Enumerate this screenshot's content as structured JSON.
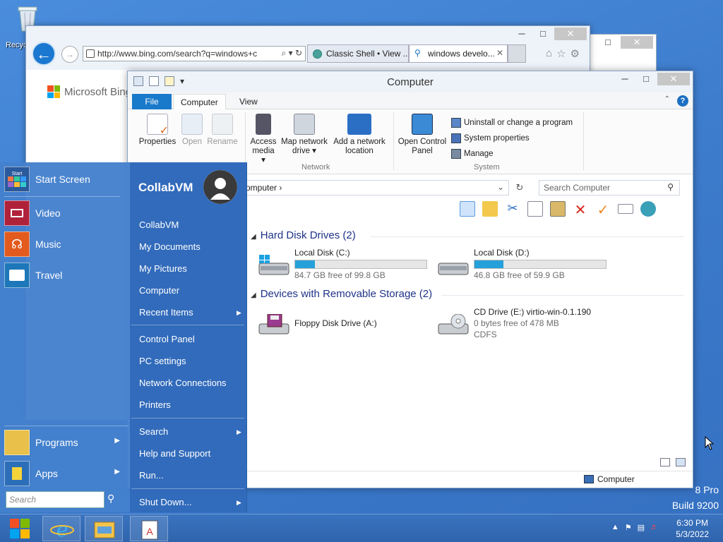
{
  "desktop": {
    "recycle_label": "Recyc",
    "watermark_line1": "8 Pro",
    "watermark_line2": "Build 9200"
  },
  "ie": {
    "address": "http://www.bing.com/search?q=windows+c",
    "address_tools": "⌕ ▾ ↻",
    "tabs": [
      {
        "label": "Classic Shell • View ..."
      },
      {
        "label": "windows develo...",
        "close": "✕"
      }
    ],
    "page_logo_text": "Microsoft Bing"
  },
  "explorer": {
    "title": "Computer",
    "ribbon_tabs": {
      "file": "File",
      "computer": "Computer",
      "view": "View"
    },
    "ribbon": {
      "properties": "Properties",
      "open": "Open",
      "rename": "Rename",
      "access_media": "Access media ▾",
      "map_network_drive": "Map network drive ▾",
      "add_network_location": "Add a network location",
      "open_control_panel": "Open Control Panel",
      "uninstall": "Uninstall or change a program",
      "system_properties": "System properties",
      "manage": "Manage",
      "group_network": "Network",
      "group_system": "System"
    },
    "breadcrumb": "omputer  ›",
    "search_placeholder": "Search Computer",
    "groups": {
      "hard_disk": "Hard Disk Drives (2)",
      "removable": "Devices with Removable Storage (2)"
    },
    "drives": [
      {
        "name": "Local Disk (C:)",
        "free": "84.7 GB free of 99.8 GB",
        "used_fraction": 0.15
      },
      {
        "name": "Local Disk (D:)",
        "free": "46.8 GB free of 59.9 GB",
        "used_fraction": 0.22
      },
      {
        "name": "Floppy Disk Drive (A:)"
      },
      {
        "name": "CD Drive (E:) virtio-win-0.1.190",
        "free": "0 bytes free of 478 MB",
        "fs": "CDFS"
      }
    ],
    "status_location": "Computer"
  },
  "start_menu": {
    "left_items": [
      {
        "label": "Start Screen"
      },
      {
        "label": "Video"
      },
      {
        "label": "Music"
      },
      {
        "label": "Travel"
      },
      {
        "label": "Programs"
      },
      {
        "label": "Apps"
      }
    ],
    "search_placeholder": "Search",
    "user_name": "CollabVM",
    "right_items": [
      {
        "label": "CollabVM"
      },
      {
        "label": "My Documents"
      },
      {
        "label": "My Pictures"
      },
      {
        "label": "Computer"
      },
      {
        "label": "Recent Items"
      },
      {
        "label": "Control Panel"
      },
      {
        "label": "PC settings"
      },
      {
        "label": "Network Connections"
      },
      {
        "label": "Printers"
      },
      {
        "label": "Search"
      },
      {
        "label": "Help and Support"
      },
      {
        "label": "Run..."
      },
      {
        "label": "Shut Down..."
      }
    ],
    "start_tile_text": "Start"
  },
  "taskbar": {
    "time": "6:30 PM",
    "date": "5/3/2022"
  },
  "colors": {
    "desktop": "#3c7acb",
    "start_menu": "#4480cd",
    "accent": "#1979ca"
  }
}
